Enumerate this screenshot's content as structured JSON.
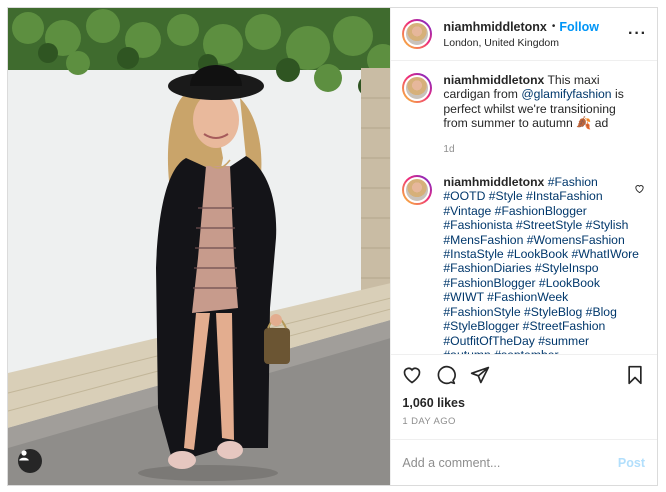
{
  "header": {
    "username": "niamhmiddletonx",
    "separator": "•",
    "follow_label": "Follow",
    "location": "London, United Kingdom",
    "more_icon": "more-options-icon"
  },
  "caption": {
    "username": "niamhmiddletonx",
    "text_before": " This maxi cardigan from ",
    "mention": "@glamifyfashion",
    "text_after": " is perfect whilst we're transitioning from summer to autumn 🍂 ad",
    "time": "1d"
  },
  "hashtag_comment": {
    "username": "niamhmiddletonx",
    "tags": " #Fashion #OOTD #Style #InstaFashion #Vintage #FashionBlogger #Fashionista #StreetStyle #Stylish #MensFashion #WomensFashion #InstaStyle #LookBook #WhatIWore #FashionDiaries #StyleInspo #FashionBlogger #LookBook #WIWT #FashionWeek #FashionStyle #StyleBlog #Blog #StyleBlogger #StreetFashion #OutfitOfTheDay #summer #autumn #september"
  },
  "actions": {
    "icons": [
      "heart-icon",
      "comment-icon",
      "share-icon",
      "bookmark-icon"
    ]
  },
  "likes": "1,060 likes",
  "time_ago": "1 DAY AGO",
  "add_comment": {
    "placeholder": "Add a comment...",
    "post_label": "Post"
  },
  "colors": {
    "link_blue": "#0095f6",
    "post_disabled": "#b2dffc",
    "hashtag": "#00376b",
    "muted": "#8e8e8e"
  }
}
